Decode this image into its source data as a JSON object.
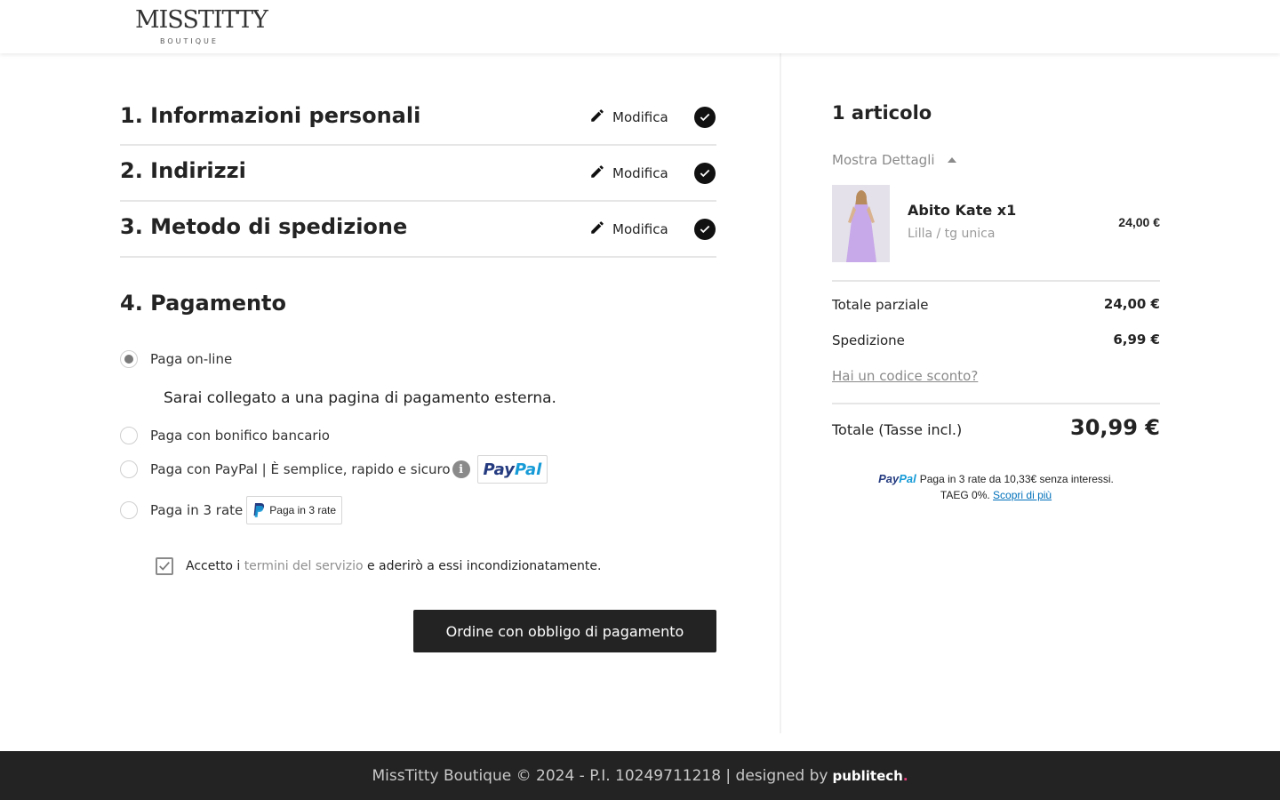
{
  "header": {
    "logo_main": "MISSTITTY",
    "logo_sub": "BOUTIQUE"
  },
  "steps": [
    {
      "title": "1. Informazioni personali",
      "edit_label": "Modifica"
    },
    {
      "title": "2. Indirizzi",
      "edit_label": "Modifica"
    },
    {
      "title": "3. Metodo di spedizione",
      "edit_label": "Modifica"
    }
  ],
  "payment": {
    "title": "4. Pagamento",
    "options": [
      {
        "label": "Paga on-line",
        "selected": true
      },
      {
        "label": "Paga con bonifico bancario",
        "selected": false
      },
      {
        "label": "Paga con PayPal | È semplice, rapido e sicuro",
        "selected": false,
        "badge": "PayPal"
      },
      {
        "label": "Paga in 3 rate",
        "selected": false,
        "badge": "Paga in 3 rate"
      }
    ],
    "external_note": "Sarai collegato a una pagina di pagamento esterna.",
    "info_icon": "i",
    "paypal_badge_pay": "Pay",
    "paypal_badge_pal": "Pal",
    "terms_prefix": "Accetto i ",
    "terms_link": "termini del servizio",
    "terms_suffix": " e aderirò a essi incondizionatamente.",
    "terms_checked": true,
    "order_button": "Ordine con obbligo di pagamento"
  },
  "cart": {
    "count": "1 articolo",
    "details_toggle": "Mostra Dettagli",
    "product": {
      "name": "Abito Kate x1",
      "variant": "Lilla / tg unica",
      "price": "24,00 €"
    },
    "subtotal_label": "Totale parziale",
    "subtotal_value": "24,00 €",
    "shipping_label": "Spedizione",
    "shipping_value": "6,99 €",
    "discount_link": "Hai un codice sconto?",
    "total_label": "Totale (Tasse incl.)",
    "total_value": "30,99 €",
    "paypal_message_line1": "Paga in 3 rate da 10,33€ senza interessi.",
    "paypal_message_line2": "TAEG 0%.",
    "paypal_message_link": "Scopri di più"
  },
  "footer": {
    "text": "MissTitty Boutique © 2024 - P.I. 10249711218 | designed by",
    "brand": "publitech",
    "brand_dot": "."
  },
  "colors": {
    "dark": "#232323",
    "muted": "#8a8a8a",
    "paypal_dark": "#253b80",
    "paypal_light": "#179bd7",
    "accent_dot": "#e63b7a"
  }
}
